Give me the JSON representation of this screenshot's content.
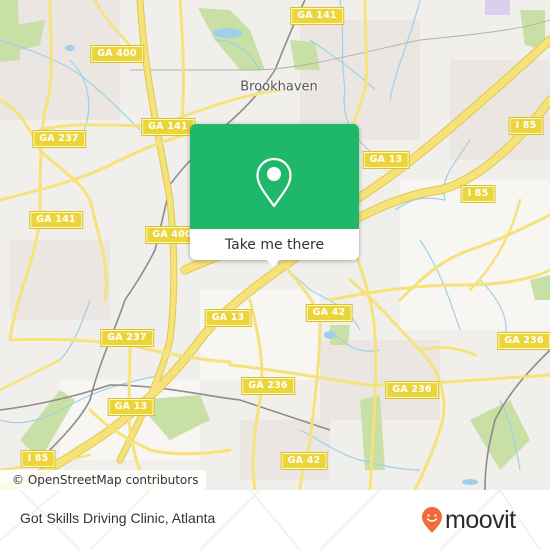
{
  "map": {
    "colors": {
      "background": "#f1efeb",
      "road": "#f6e27a",
      "road_casing": "#e2c94a",
      "water": "#9fd0e8",
      "park": "#c8dfa6",
      "rail": "#8c8c8c",
      "accent": "#1fb76a"
    },
    "place_labels": [
      {
        "text": "Brookhaven"
      }
    ],
    "road_labels": [
      {
        "text": "GA 141"
      },
      {
        "text": "GA 400"
      },
      {
        "text": "GA 237"
      },
      {
        "text": "GA 141"
      },
      {
        "text": "GA 13"
      },
      {
        "text": "I 85"
      },
      {
        "text": "GA 141"
      },
      {
        "text": "GA 400"
      },
      {
        "text": "I 85"
      },
      {
        "text": "GA 13"
      },
      {
        "text": "GA 42"
      },
      {
        "text": "GA 237"
      },
      {
        "text": "GA 236"
      },
      {
        "text": "GA 236"
      },
      {
        "text": "GA 236"
      },
      {
        "text": "GA 13"
      },
      {
        "text": "I 85"
      },
      {
        "text": "GA 42"
      }
    ],
    "attribution": "© OpenStreetMap contributors"
  },
  "popup": {
    "icon": "map-pin-icon",
    "button_label": "Take me there"
  },
  "footer": {
    "place_name": "Got Skills Driving Clinic, Atlanta",
    "brand": "moovit",
    "brand_color": "#f26b3a"
  }
}
